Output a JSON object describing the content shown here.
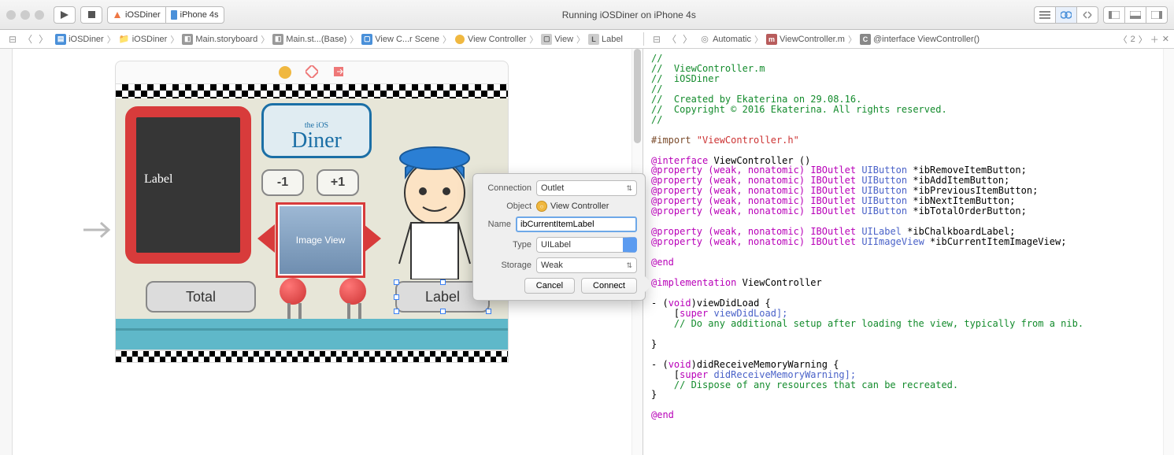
{
  "toolbar": {
    "scheme": "iOSDiner",
    "device": "iPhone 4s",
    "status": "Running iOSDiner on iPhone 4s"
  },
  "jumpbar_left": {
    "items": [
      "iOSDiner",
      "iOSDiner",
      "Main.storyboard",
      "Main.st...(Base)",
      "View C...r Scene",
      "View Controller",
      "View",
      "Label"
    ]
  },
  "jumpbar_right": {
    "mode": "Automatic",
    "file": "ViewController.m",
    "scope": "@interface ViewController()",
    "counter": "2"
  },
  "scene": {
    "chalk": "Label",
    "sign_top": "the iOS",
    "sign_main": "Diner",
    "minus": "-1",
    "plus": "+1",
    "imgview": "Image View",
    "total": "Total",
    "label": "Label"
  },
  "popover": {
    "fields": {
      "connection": "Connection",
      "object": "Object",
      "name": "Name",
      "type": "Type",
      "storage": "Storage"
    },
    "connection": "Outlet",
    "object": "View Controller",
    "name": "ibCurrentItemLabel",
    "type": "UILabel",
    "storage": "Weak",
    "cancel": "Cancel",
    "connect": "Connect"
  },
  "code": {
    "c1": "//",
    "c2": "//  ViewController.m",
    "c3": "//  iOSDiner",
    "c4": "//",
    "c5": "//  Created by Ekaterina on 29.08.16.",
    "c6": "//  Copyright © 2016 Ekaterina. All rights reserved.",
    "c7": "//",
    "imp": "#import ",
    "imp_s": "\"ViewController.h\"",
    "iface": "@interface",
    "iface_rest": " ViewController ()",
    "prop": "@property",
    "attrs": " (weak, nonatomic) ",
    "ibo": "IBOutlet",
    "t_btn": " UIButton ",
    "t_lbl": " UILabel ",
    "t_img": " UIImageView ",
    "p1": "*ibRemoveItemButton;",
    "p2": "*ibAddItemButton;",
    "p3": "*ibPreviousItemButton;",
    "p4": "*ibNextItemButton;",
    "p5": "*ibTotalOrderButton;",
    "p6": "*ibChalkboardLabel;",
    "p7": "*ibCurrentItemImageView;",
    "end": "@end",
    "impl": "@implementation",
    "impl_rest": " ViewController",
    "m1a": "- (",
    "void": "void",
    "m1b": ")viewDidLoad {",
    "m1c": "    [",
    "super": "super",
    "m1d": " viewDidLoad];",
    "m1e": "    // Do any additional setup after loading the view, typically from a nib.",
    "brace": "}",
    "m2b": ")didReceiveMemoryWarning {",
    "m2d": " didReceiveMemoryWarning];",
    "m2e": "    // Dispose of any resources that can be recreated."
  }
}
